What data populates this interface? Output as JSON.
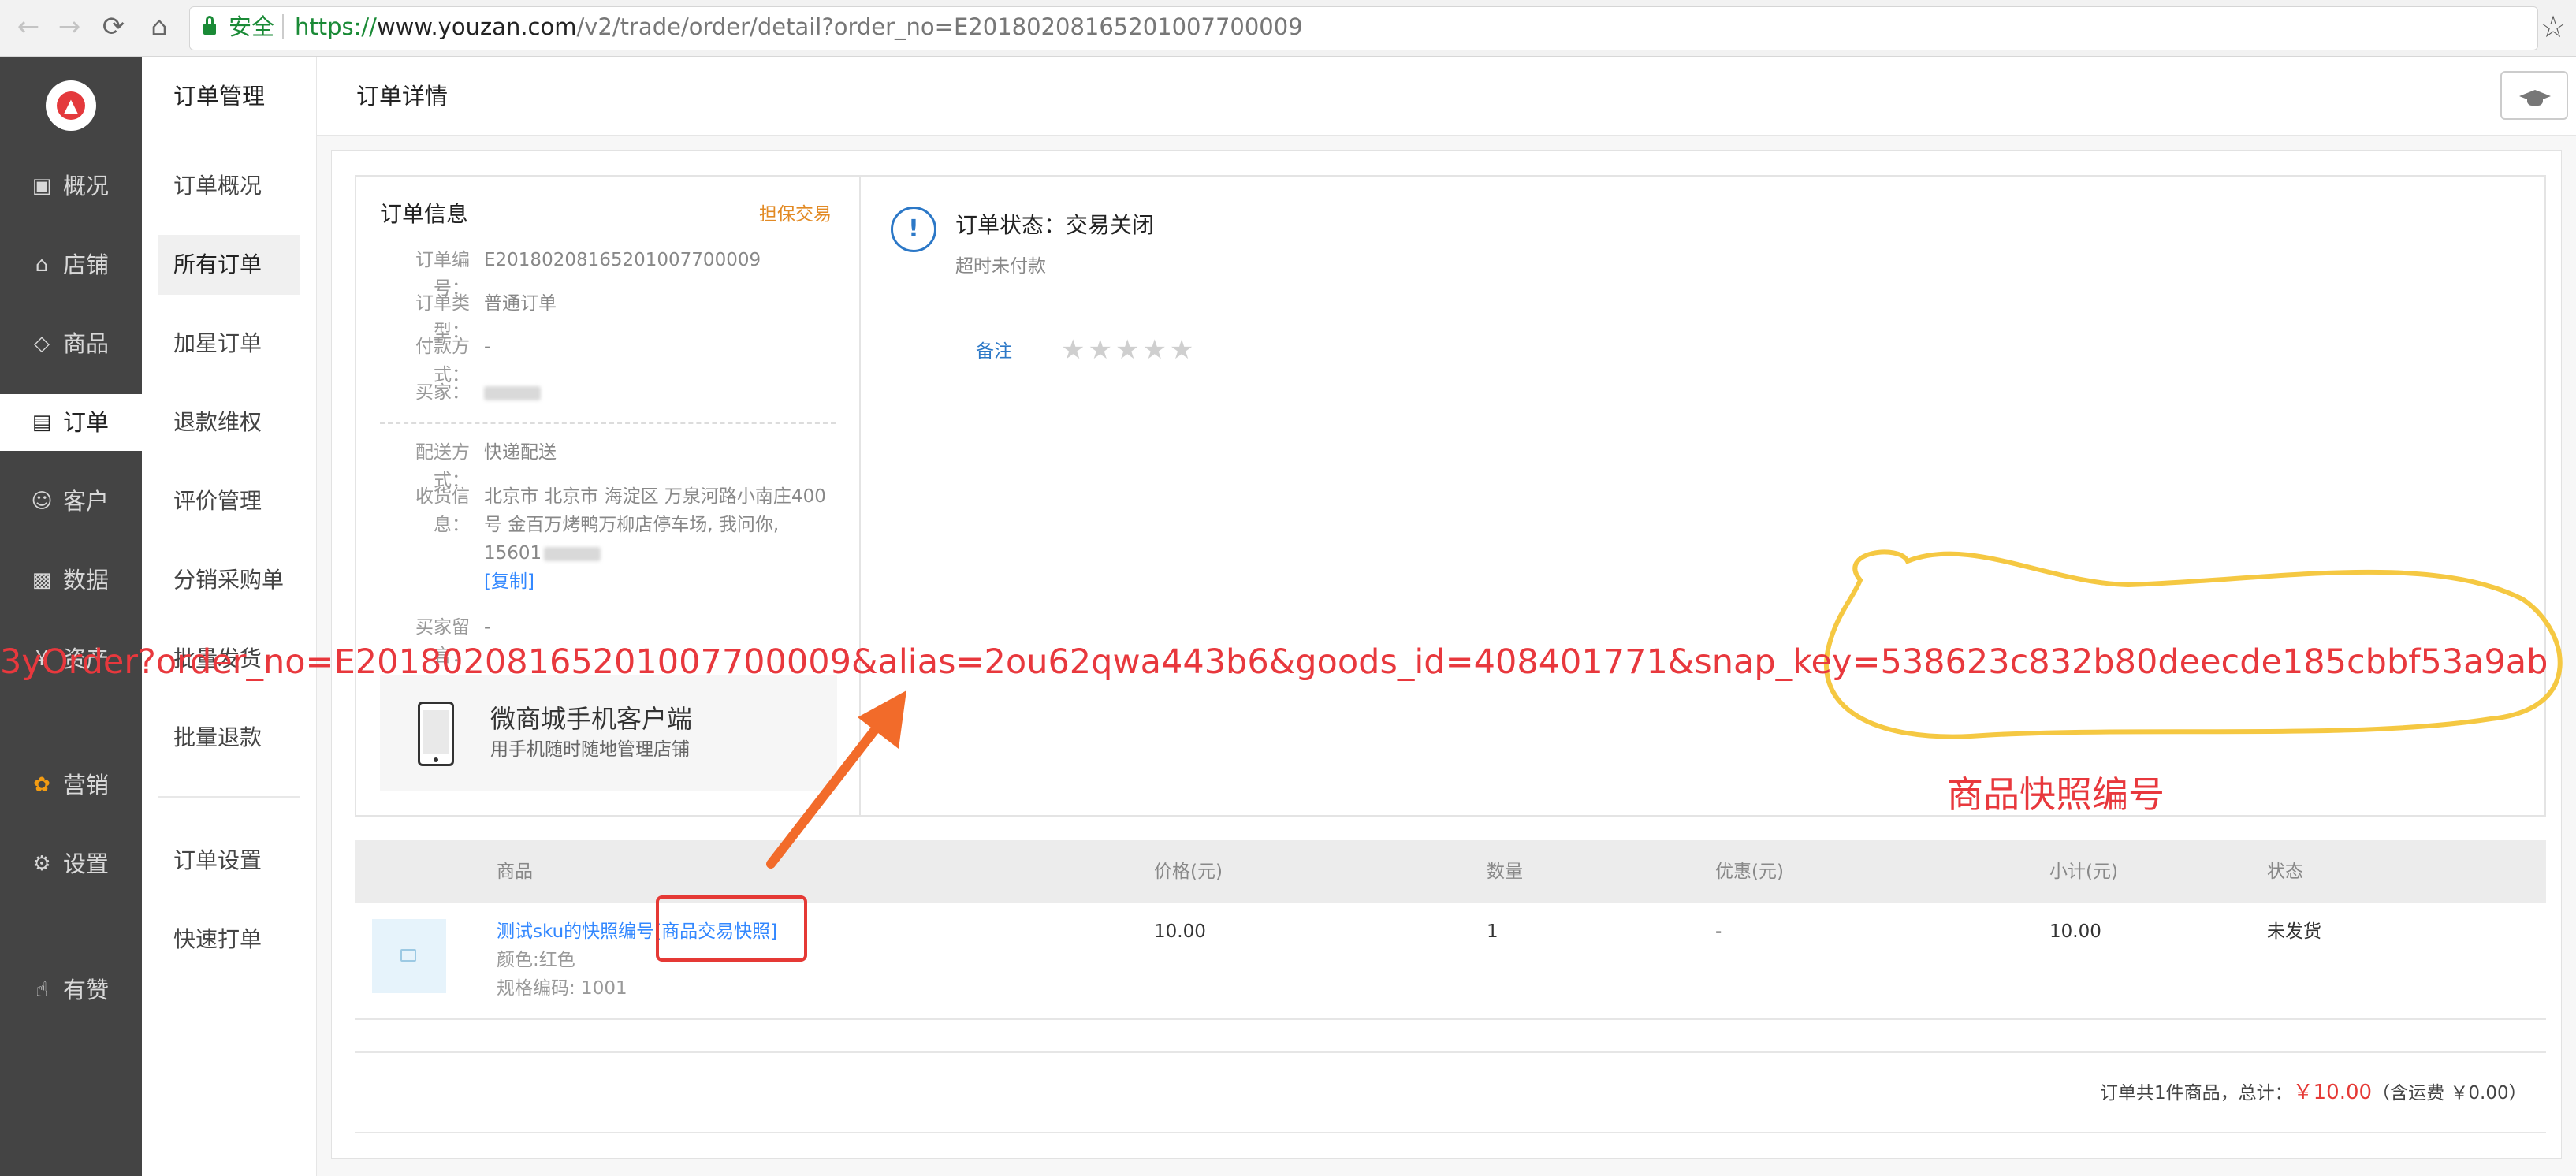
{
  "browser": {
    "secure_label": "安全",
    "url_proto": "https://",
    "url_host": "www.youzan.com",
    "url_path": "/v2/trade/order/detail?order_no=E20180208165201007700009",
    "nav_back": "←",
    "nav_forward": "→",
    "nav_reload": "⟳",
    "nav_home": "⌂",
    "bookmark": "☆"
  },
  "sidebar_primary": {
    "logo_icon": "thumbs-up",
    "items": [
      {
        "label": "概况",
        "icon": "monitor-icon"
      },
      {
        "label": "店铺",
        "icon": "store-icon"
      },
      {
        "label": "商品",
        "icon": "tag-icon"
      },
      {
        "label": "订单",
        "icon": "document-icon"
      },
      {
        "label": "客户",
        "icon": "user-icon"
      },
      {
        "label": "数据",
        "icon": "bar-chart-icon"
      },
      {
        "label": "资产",
        "icon": "yen-icon"
      },
      {
        "label": "营销",
        "icon": "grid-icon"
      },
      {
        "label": "设置",
        "icon": "gear-icon"
      },
      {
        "label": "有赞",
        "icon": "thumb-icon"
      }
    ]
  },
  "sidebar_secondary": {
    "title": "订单管理",
    "items": [
      {
        "label": "订单概况"
      },
      {
        "label": "所有订单"
      },
      {
        "label": "加星订单"
      },
      {
        "label": "退款维权"
      },
      {
        "label": "评价管理"
      },
      {
        "label": "分销采购单"
      },
      {
        "label": "批量发货"
      },
      {
        "label": "批量退款"
      },
      {
        "label": "订单设置"
      },
      {
        "label": "快速打单"
      }
    ]
  },
  "main": {
    "title": "订单详情"
  },
  "order_info": {
    "title": "订单信息",
    "badge": "担保交易",
    "fields": {
      "order_no": {
        "label": "订单编号：",
        "value": "E20180208165201007700009"
      },
      "order_type": {
        "label": "订单类型：",
        "value": "普通订单"
      },
      "pay_method": {
        "label": "付款方式：",
        "value": "-"
      },
      "buyer": {
        "label": "买家："
      },
      "delivery": {
        "label": "配送方式：",
        "value": "快递配送"
      },
      "address": {
        "label": "收货信息：",
        "line1": "北京市 北京市 海淀区 万泉河路小南庄400",
        "line2": "号 金百万烤鸭万柳店停车场, 我问你,",
        "line3": "15601"
      },
      "copy": "[复制]",
      "message": {
        "label": "买家留言：",
        "value": "-"
      }
    },
    "promo": {
      "title": "微商城手机客户端",
      "subtitle": "用手机随时随地管理店铺"
    }
  },
  "order_status": {
    "icon": "!",
    "text": "订单状态：交易关闭",
    "sub": "超时未付款",
    "remark": "备注",
    "stars": "★★★★★",
    "star_rating": 0
  },
  "annotation": {
    "url": "3yOrder?order_no=E20180208165201007700009&alias=2ou62qwa443b6&goods_id=408401771&snap_key=538623c832b80deecde185cbbf53a9ab",
    "label": "商品快照编号",
    "color_red": "#e8383d",
    "color_yellow": "#f5c842",
    "color_orange": "#f26b2a"
  },
  "goods_table": {
    "headers": [
      "商品",
      "价格(元)",
      "数量",
      "优惠(元)",
      "小计(元)",
      "状态"
    ],
    "rows": [
      {
        "name": "测试sku的快照编号",
        "snapshot_link": "[商品交易快照]",
        "color": "颜色:红色",
        "sku_code": "规格编码: 1001",
        "price": "10.00",
        "qty": "1",
        "discount": "-",
        "subtotal": "10.00",
        "status": "未发货"
      }
    ],
    "summary_prefix": "订单共1件商品，总计：",
    "summary_amount": "￥10.00",
    "summary_suffix": "（含运费 ￥0.00）"
  }
}
